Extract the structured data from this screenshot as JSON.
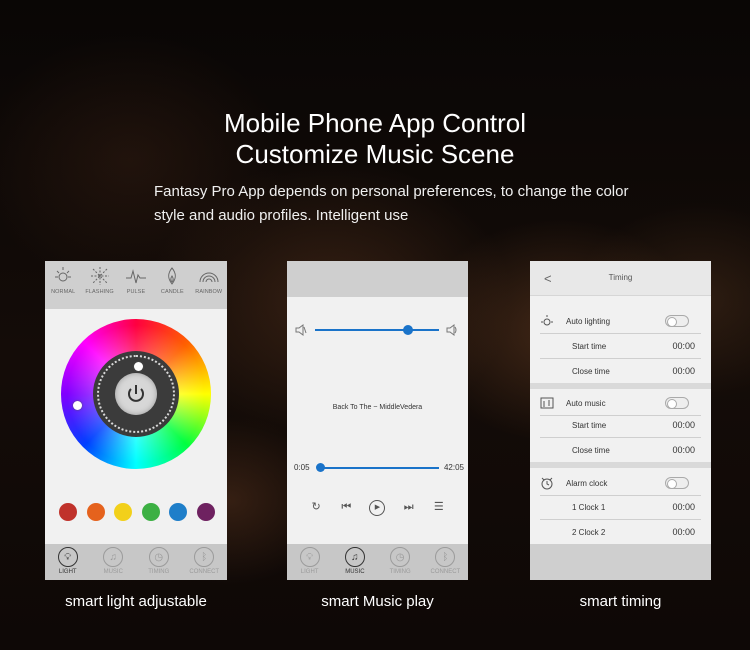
{
  "heading": {
    "line1": "Mobile Phone App Control",
    "line2": "Customize Music Scene"
  },
  "description": {
    "line1": "Fantasy  Pro App depends on personal preferences, to change the color",
    "line2": "style and audio profiles. Intelligent use"
  },
  "captions": {
    "light": "smart light adjustable",
    "music": "smart Music play",
    "timing": "smart timing"
  },
  "light_screen": {
    "modes": [
      "NORMAL",
      "FLASHING",
      "PULSE",
      "CANDLE",
      "RAINBOW"
    ],
    "swatches": [
      "#c0322b",
      "#e5621d",
      "#f2d01a",
      "#3cb043",
      "#1e7ec9",
      "#6e2160"
    ]
  },
  "tabs": [
    {
      "label": "LIGHT",
      "icon": "bulb-icon"
    },
    {
      "label": "MUSIC",
      "icon": "music-icon"
    },
    {
      "label": "TIMING",
      "icon": "clock-icon"
    },
    {
      "label": "CONNECT",
      "icon": "bluetooth-icon"
    }
  ],
  "music_screen": {
    "song": "Back To The ~ MiddleVedera",
    "elapsed": "0:05",
    "total": "42:05"
  },
  "timing_screen": {
    "title": "Timing",
    "back": "<",
    "auto_lighting": "Auto lighting",
    "auto_lighting_start_label": "Start time",
    "auto_lighting_start": "00:00",
    "auto_lighting_close_label": "Close time",
    "auto_lighting_close": "00:00",
    "auto_music": "Auto music",
    "auto_music_start_label": "Start time",
    "auto_music_start": "00:00",
    "auto_music_close_label": "Close time",
    "auto_music_close": "00:00",
    "alarm_clock": "Alarm clock",
    "clock1_label": "1 Clock 1",
    "clock1": "00:00",
    "clock2_label": "2 Clock 2",
    "clock2": "00:00"
  }
}
